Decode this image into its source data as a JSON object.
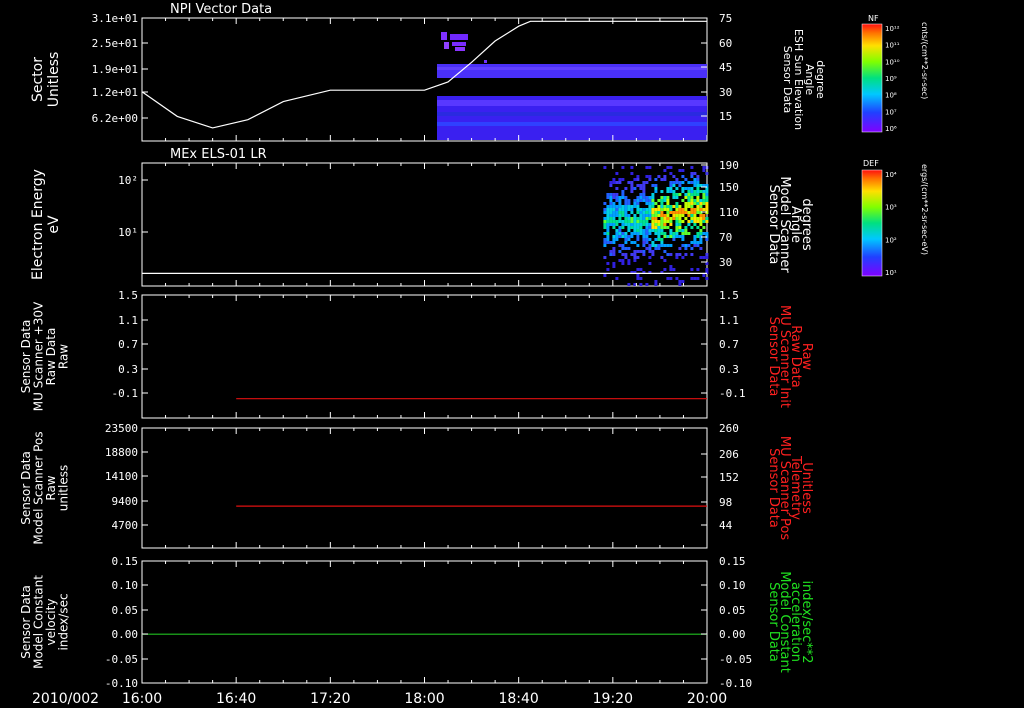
{
  "time_axis": {
    "date_label": "2010/002",
    "ticks": [
      "16:00",
      "16:40",
      "17:20",
      "18:00",
      "18:40",
      "19:20",
      "20:00"
    ]
  },
  "chart_data": [
    {
      "type": "heatmap",
      "title": "NPI Vector Data",
      "ylabel_lines": [
        "Sector",
        "Unitless"
      ],
      "y_ticks": [
        "3.1e+01",
        "2.5e+01",
        "1.9e+01",
        "1.2e+01",
        "6.2e+00"
      ],
      "right_ticks": [
        "75",
        "60",
        "45",
        "30",
        "15"
      ],
      "right_label_lines": [
        "Sensor Data",
        "ESH Sun Elevation",
        "Angle",
        "degree"
      ],
      "right_label_color": "#ffffff",
      "line_series": {
        "name": "ESH Sun Elevation Angle",
        "x": [
          "16:00",
          "16:15",
          "16:30",
          "16:45",
          "17:00",
          "17:20",
          "17:40",
          "18:00",
          "18:10",
          "18:20",
          "18:30",
          "18:40",
          "18:45",
          "20:00"
        ],
        "y": [
          30,
          15,
          8,
          13,
          24,
          31,
          31,
          31,
          36,
          48,
          61,
          70,
          73,
          73
        ]
      },
      "colorbar": {
        "label": "NF",
        "units": "cnts/(cm**2-sr-sec)",
        "ticks": [
          "10¹²",
          "10¹¹",
          "10¹⁰",
          "10⁹",
          "10⁸",
          "10⁷",
          "10⁶"
        ]
      }
    },
    {
      "type": "heatmap",
      "title": "MEx ELS-01 LR",
      "ylabel_lines": [
        "Electron Energy",
        "eV"
      ],
      "y_ticks": [
        "10²",
        "10¹"
      ],
      "right_ticks": [
        "190",
        "150",
        "110",
        "70",
        "30"
      ],
      "right_label_lines": [
        "Sensor Data",
        "Model Scanner",
        "Angle",
        "degrees"
      ],
      "right_label_color": "#ffffff",
      "line_series": {
        "name": "Model Scanner Angle",
        "x": [
          "16:00",
          "20:00"
        ],
        "y": [
          1.6,
          1.6
        ]
      },
      "colorbar": {
        "label": "DEF",
        "units": "ergs/(cm**2-sr-sec-eV)",
        "ticks": [
          "10⁴",
          "10³",
          "10²",
          "10¹"
        ]
      }
    },
    {
      "type": "line",
      "ylabel_lines": [
        "Sensor Data",
        "MU Scanner +30V",
        "Raw Data",
        "Raw"
      ],
      "y_ticks": [
        "1.5",
        "1.1",
        "0.7",
        "0.3",
        "-0.1"
      ],
      "right_ticks": [
        "1.5",
        "1.1",
        "0.7",
        "0.3",
        "-0.1"
      ],
      "right_label_lines": [
        "Sensor Data",
        "MU Scanner Init",
        "Raw Data",
        "Raw"
      ],
      "right_label_color": "#ff2020",
      "series": [
        {
          "color": "#e01010",
          "x": [
            "16:40",
            "20:00"
          ],
          "y": [
            0.0,
            0.0
          ]
        }
      ]
    },
    {
      "type": "line",
      "ylabel_lines": [
        "Sensor Data",
        "Model Scanner Pos",
        "Raw",
        "unitless"
      ],
      "y_ticks": [
        "23500",
        "18800",
        "14100",
        "9400",
        "4700"
      ],
      "right_ticks": [
        "260",
        "206",
        "152",
        "98",
        "44"
      ],
      "right_label_lines": [
        "Sensor Data",
        "MU Scanner Pos",
        "Telemetry",
        "Unitless"
      ],
      "right_label_color": "#ff2020",
      "series": [
        {
          "color": "#e01010",
          "x": [
            "16:40",
            "20:00"
          ],
          "y": [
            8200,
            8200
          ]
        }
      ]
    },
    {
      "type": "line",
      "ylabel_lines": [
        "Sensor Data",
        "Model Constant",
        "velocity",
        "index/sec"
      ],
      "y_ticks": [
        "0.15",
        "0.10",
        "0.05",
        "0.00",
        "-0.05",
        "-0.10"
      ],
      "right_ticks": [
        "0.15",
        "0.10",
        "0.05",
        "0.00",
        "-0.05",
        "-0.10"
      ],
      "right_label_lines": [
        "Sensor Data",
        "Model Constant",
        "acceleration",
        "index/sec**2"
      ],
      "right_label_color": "#20e020",
      "series": [
        {
          "color": "#20c020",
          "x": [
            "16:00",
            "20:00"
          ],
          "y": [
            0.0,
            0.0
          ]
        }
      ]
    }
  ]
}
